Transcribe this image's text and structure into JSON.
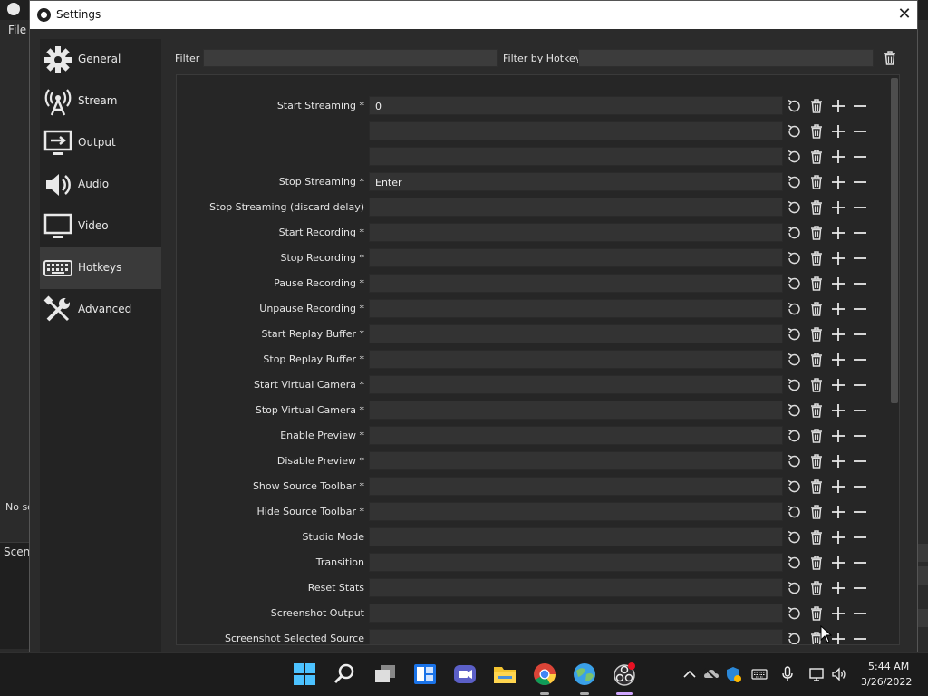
{
  "background": {
    "menu_file": "File",
    "no_source": "No so",
    "scenes": "Scene"
  },
  "dialog": {
    "title": "Settings",
    "close_glyph": "✕"
  },
  "sidebar": {
    "items": [
      {
        "label": "General",
        "icon": "gear-icon"
      },
      {
        "label": "Stream",
        "icon": "broadcast-icon"
      },
      {
        "label": "Output",
        "icon": "output-monitor-icon"
      },
      {
        "label": "Audio",
        "icon": "speaker-icon"
      },
      {
        "label": "Video",
        "icon": "monitor-icon"
      },
      {
        "label": "Hotkeys",
        "icon": "keyboard-icon",
        "active": true
      },
      {
        "label": "Advanced",
        "icon": "tools-icon"
      }
    ]
  },
  "filters": {
    "filter_label": "Filter",
    "filter_value": "",
    "hotkey_label": "Filter by Hotkey",
    "hotkey_value": ""
  },
  "hotkeys": [
    {
      "label": "Start Streaming *",
      "value": "0"
    },
    {
      "label": "",
      "value": ""
    },
    {
      "label": "",
      "value": ""
    },
    {
      "label": "Stop Streaming *",
      "value": "Enter"
    },
    {
      "label": "Stop Streaming (discard delay)",
      "value": ""
    },
    {
      "label": "Start Recording *",
      "value": ""
    },
    {
      "label": "Stop Recording *",
      "value": ""
    },
    {
      "label": "Pause Recording *",
      "value": ""
    },
    {
      "label": "Unpause Recording *",
      "value": ""
    },
    {
      "label": "Start Replay Buffer *",
      "value": ""
    },
    {
      "label": "Stop Replay Buffer *",
      "value": ""
    },
    {
      "label": "Start Virtual Camera *",
      "value": ""
    },
    {
      "label": "Stop Virtual Camera *",
      "value": ""
    },
    {
      "label": "Enable Preview *",
      "value": ""
    },
    {
      "label": "Disable Preview *",
      "value": ""
    },
    {
      "label": "Show Source Toolbar *",
      "value": ""
    },
    {
      "label": "Hide Source Toolbar *",
      "value": ""
    },
    {
      "label": "Studio Mode",
      "value": ""
    },
    {
      "label": "Transition",
      "value": ""
    },
    {
      "label": "Reset Stats",
      "value": ""
    },
    {
      "label": "Screenshot Output",
      "value": ""
    },
    {
      "label": "Screenshot Selected Source",
      "value": ""
    }
  ],
  "taskbar": {
    "apps": [
      "windows-start-icon",
      "search-icon",
      "task-view-icon",
      "widgets-icon",
      "teams-chat-icon",
      "file-explorer-icon",
      "chrome-icon",
      "maps-icon",
      "obs-icon"
    ],
    "tray": [
      "chevron-up-icon",
      "onedrive-icon",
      "defender-icon",
      "keyboard-icon",
      "microphone-icon",
      "network-icon",
      "volume-icon"
    ],
    "time": "5:44 AM",
    "date": "3/26/2022"
  },
  "colors": {
    "dialog_bg": "#2b2b2b",
    "sidebar_bg": "#232323",
    "active_item": "#3a3a3a",
    "input_bg": "#333333",
    "taskbar_bg": "#1c1c1c"
  }
}
